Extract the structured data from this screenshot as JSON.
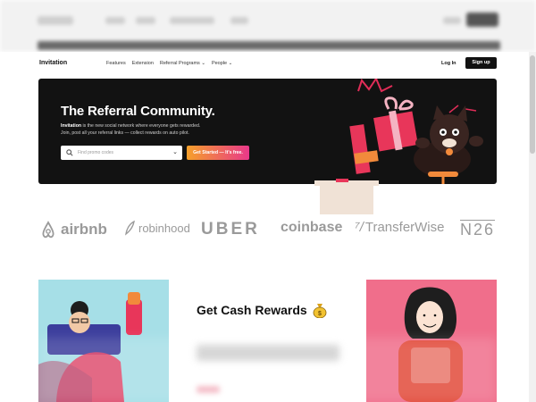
{
  "nav": {
    "brand": "Invitation",
    "links": [
      "Features",
      "Extension",
      "Referral Programs ⌄",
      "People ⌄"
    ],
    "login": "Log In",
    "signup": "Sign up"
  },
  "hero": {
    "title": "The Referral Community.",
    "subtitle_brand": "Invitation",
    "subtitle_rest": " is the new social network where everyone gets rewarded.",
    "subtitle_line2": "Join, post all your referral links — collect rewards on auto pilot.",
    "search_placeholder": "Find promo codes",
    "cta": "Get Started — It's free."
  },
  "logos": [
    "airbnb",
    "robinhood",
    "UBER",
    "coinbase",
    "TransferWise",
    "N26"
  ],
  "rewards": {
    "title": "Get Cash Rewards",
    "icon": "money-bag-icon"
  },
  "colors": {
    "hero_bg": "#121212",
    "cta_start": "#f6a02a",
    "cta_end": "#e8388a",
    "card_left": "#a6dfe7",
    "card_right": "#f06e8b"
  }
}
